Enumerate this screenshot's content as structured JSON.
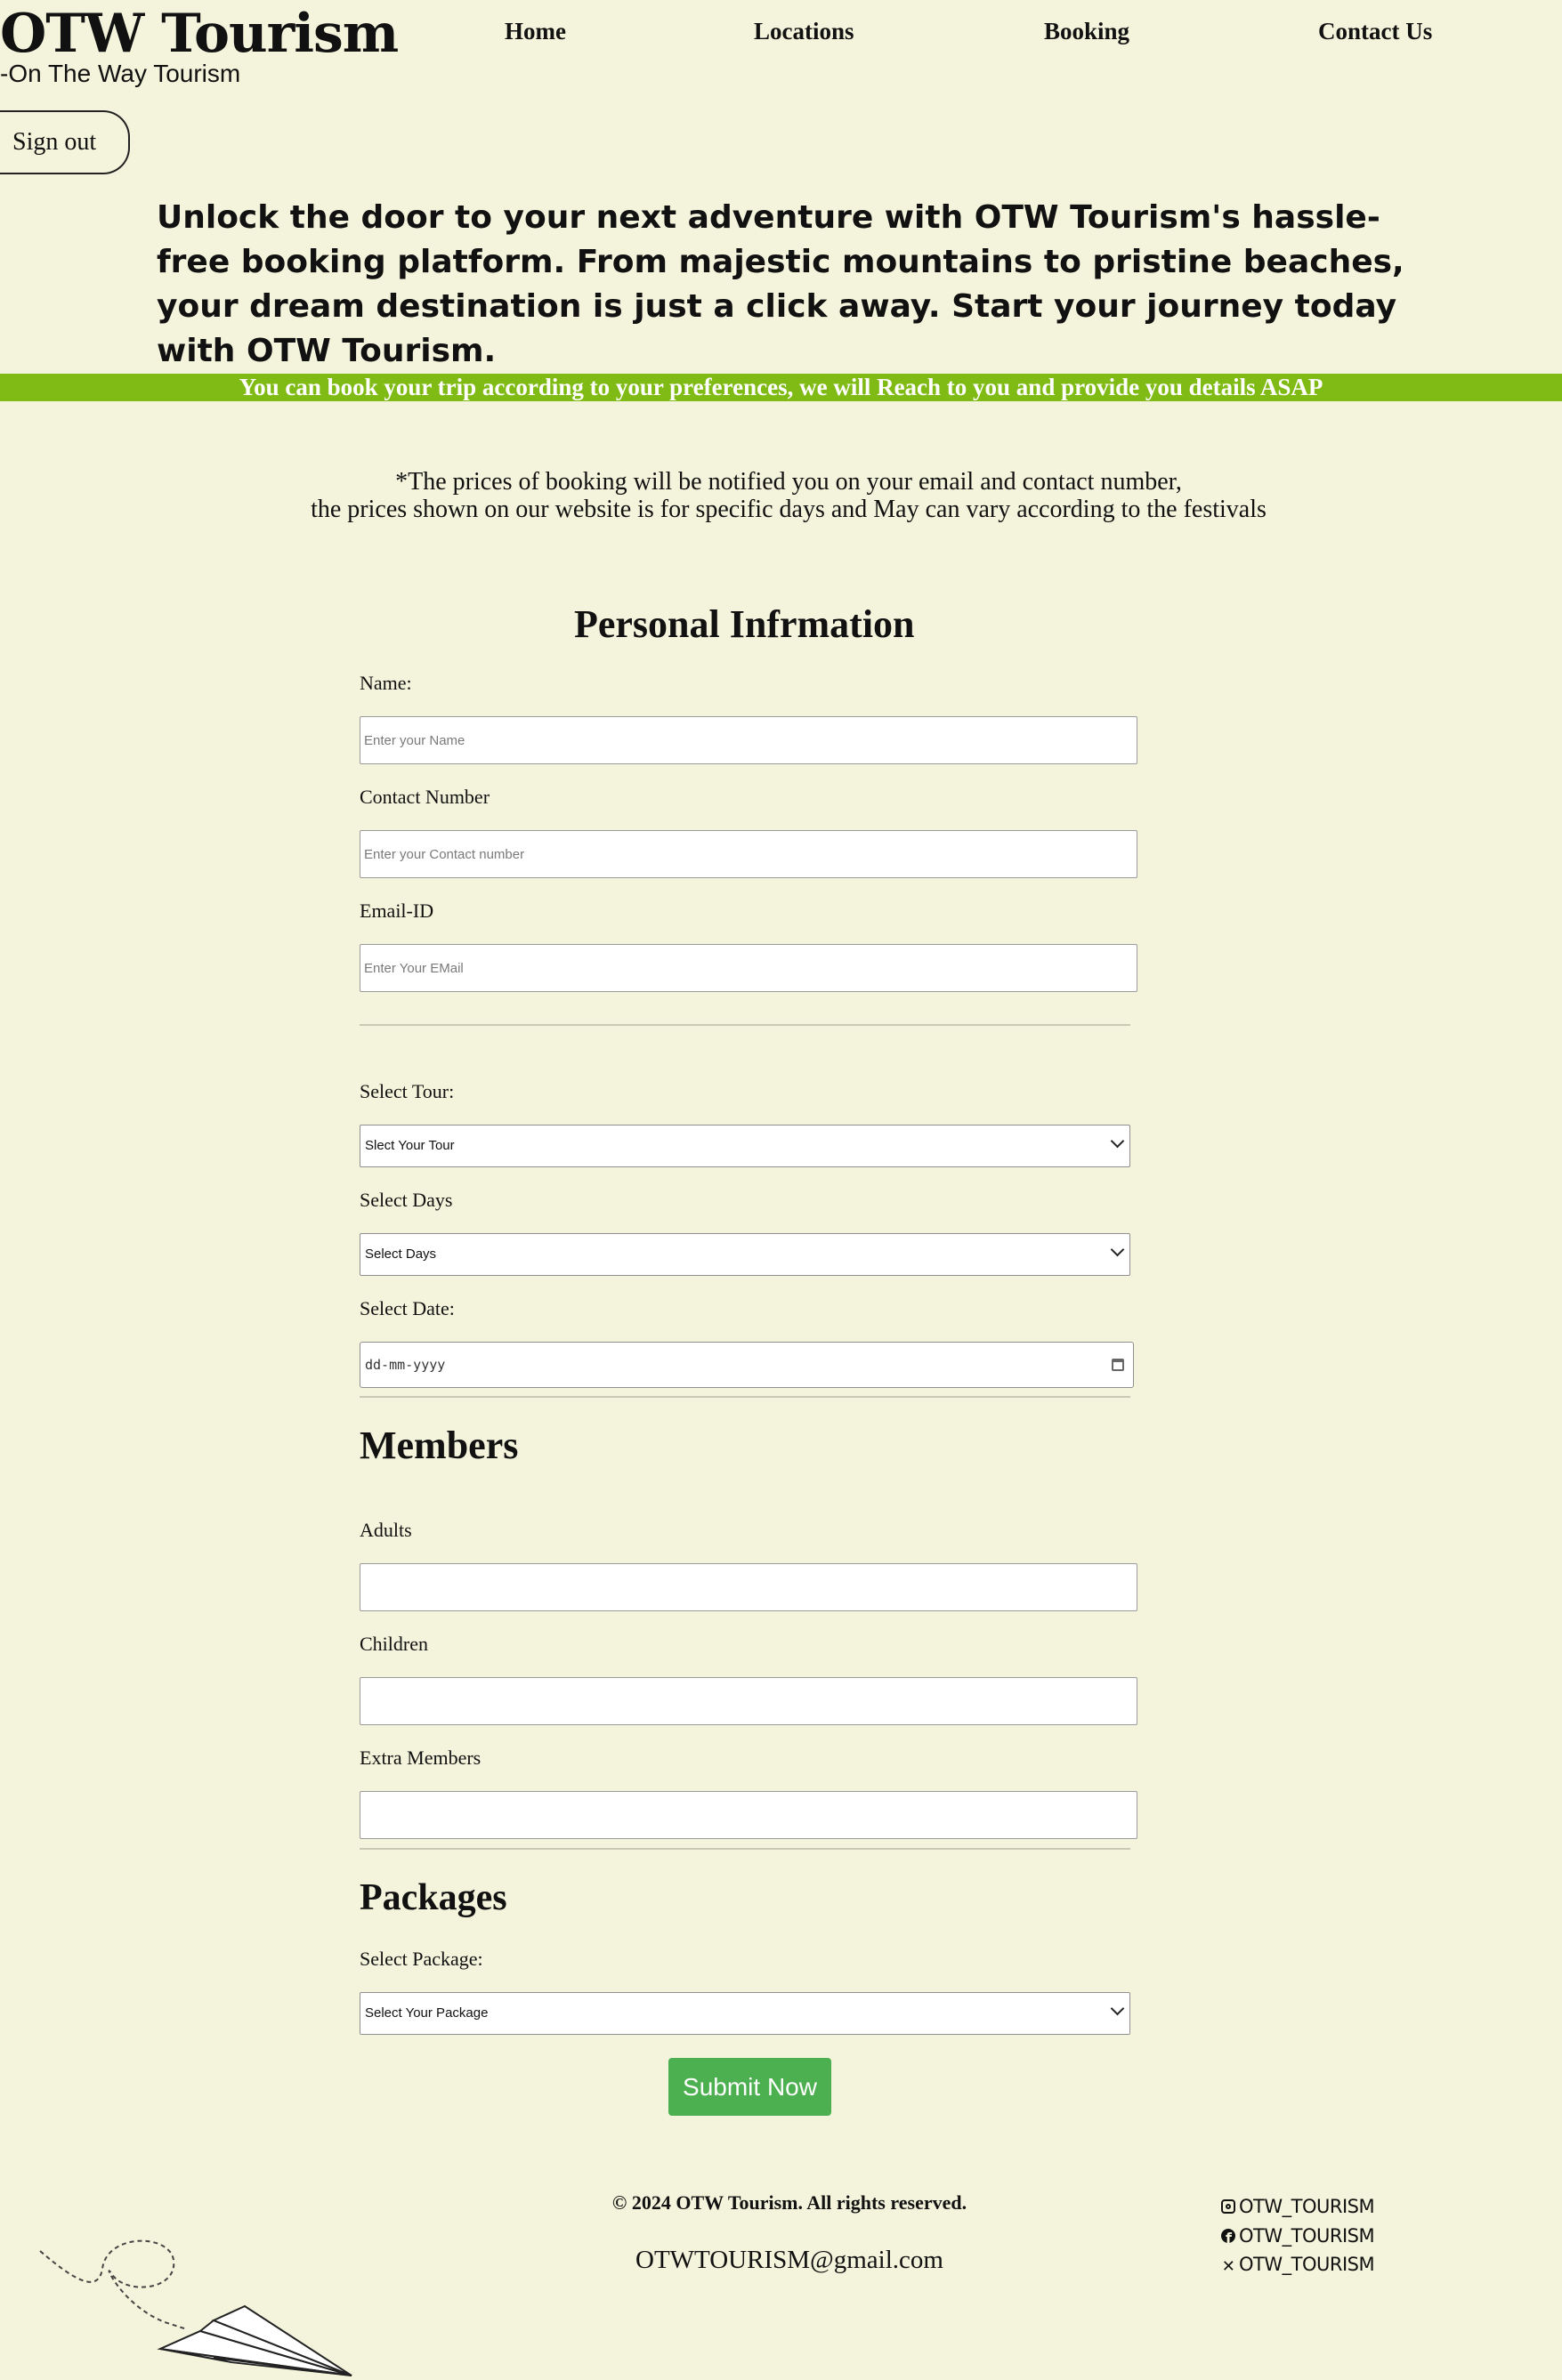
{
  "brand": {
    "logo": "OTW Tourism",
    "tagline": "-On The Way Tourism"
  },
  "nav": {
    "home": "Home",
    "locations": "Locations",
    "booking": "Booking",
    "contact": "Contact Us"
  },
  "signout_label": "Sign out",
  "hero_text": "Unlock the door to your next adventure with OTW Tourism's hassle-free booking platform. From majestic mountains to pristine beaches, your dream destination is just a click away. Start your journey today with OTW Tourism.",
  "banner_text": "You can book your trip according to your preferences, we will Reach to you and provide you details ASAP",
  "notice": {
    "line1": "*The prices of booking will be notified you on your email and contact number,",
    "line2": "the prices shown on our website is for specific days and May can vary according to the festivals"
  },
  "personal": {
    "title": "Personal Infrmation",
    "name_label": "Name:",
    "name_placeholder": "Enter your Name",
    "contact_label": "Contact Number",
    "contact_placeholder": "Enter your Contact number",
    "email_label": "Email-ID",
    "email_placeholder": "Enter Your EMail"
  },
  "tour": {
    "tour_label": "Select Tour:",
    "tour_selected": "Slect Your Tour",
    "days_label": "Select Days",
    "days_selected": "Select Days",
    "date_label": "Select Date:",
    "date_placeholder": "dd-mm-yyyy"
  },
  "members": {
    "title": "Members",
    "adults_label": "Adults",
    "children_label": "Children",
    "extra_label": "Extra Members"
  },
  "packages": {
    "title": "Packages",
    "package_label": "Select Package:",
    "package_selected": "Select Your Package"
  },
  "submit_label": "Submit Now",
  "footer": {
    "copyright": "© 2024 OTW Tourism. All rights reserved.",
    "email": "OTWTOURISM@gmail.com",
    "instagram": "OTW_TOURISM",
    "facebook": "OTW_TOURISM",
    "twitter": "OTW_TOURISM"
  },
  "colors": {
    "background": "#f4f4dc",
    "banner": "#7fbb14",
    "submit": "#4caf50"
  }
}
